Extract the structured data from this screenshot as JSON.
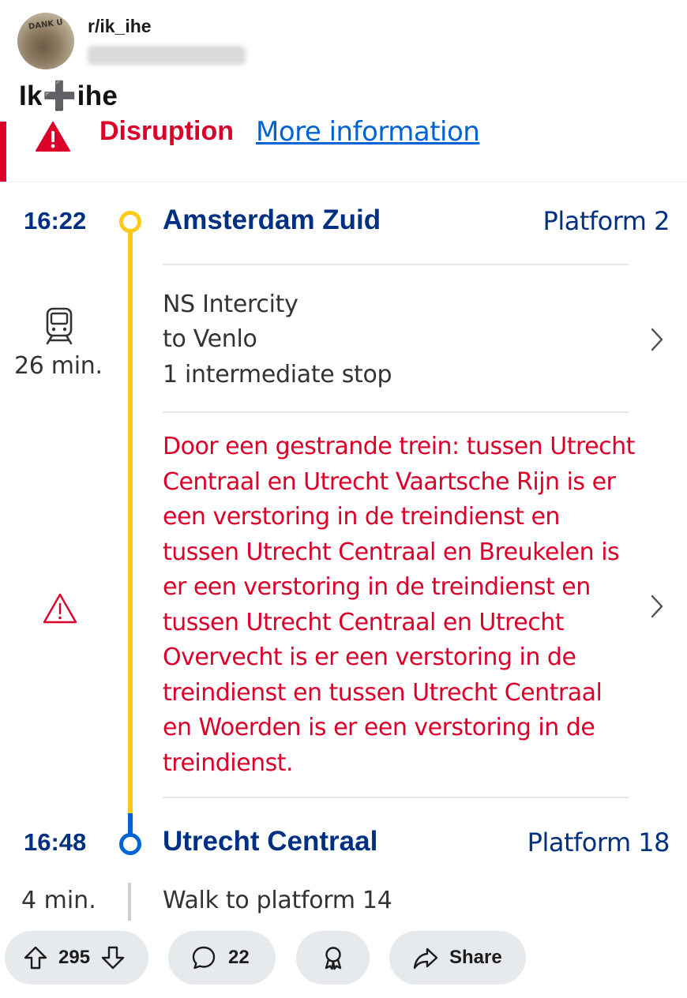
{
  "post": {
    "subreddit": "r/ik_ihe",
    "avatar_sign": "DANK U",
    "title": "Ik➕ihe"
  },
  "banner": {
    "title": "Disruption",
    "link": "More information"
  },
  "journey": {
    "departure": {
      "time": "16:22",
      "station": "Amsterdam Zuid",
      "platform": "Platform 2"
    },
    "leg": {
      "service": "NS Intercity",
      "direction": "to Venlo",
      "stops": "1 intermediate stop",
      "duration": "26 min."
    },
    "disruption_text": "Door een gestrande trein: tussen Utrecht Centraal en Utrecht Vaartsche Rijn is er een verstoring in de treindienst en tussen Utrecht Centraal en Breukelen is er een verstoring in de treindienst en tussen Utrecht Centraal en Utrecht Overvecht is er een verstoring in de treindienst en tussen Utrecht Centraal en Woerden is er een verstoring in de treindienst.",
    "arrival": {
      "time": "16:48",
      "station": "Utrecht Centraal",
      "platform": "Platform 18"
    },
    "transfer": {
      "duration": "4 min.",
      "text": "Walk to platform 14"
    }
  },
  "actions": {
    "votes": "295",
    "comments": "22",
    "share": "Share"
  },
  "colors": {
    "ns_blue": "#003082",
    "ns_yellow": "#ffc917",
    "disruption_red": "#db0029",
    "link_blue": "#0063d3"
  },
  "icons": [
    "alert-triangle-icon",
    "train-icon",
    "chevron-right-icon",
    "warning-outline-icon",
    "upvote-icon",
    "downvote-icon",
    "comment-icon",
    "award-icon",
    "share-icon"
  ]
}
